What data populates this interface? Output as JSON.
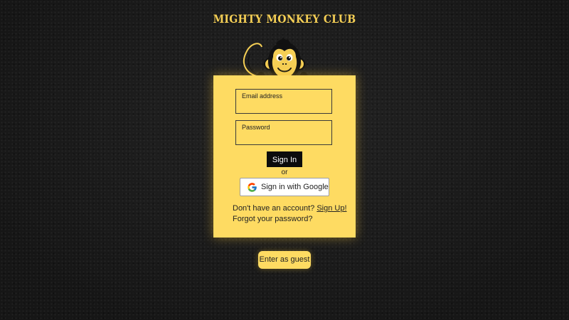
{
  "app": {
    "title": "MIGHTY MONKEY CLUB"
  },
  "login": {
    "email_label": "Email address",
    "email_value": "",
    "password_label": "Password",
    "password_value": "",
    "sign_in_label": "Sign In",
    "or_text": "or",
    "google_label": "Sign in with Google",
    "no_account_text": "Don't have an account?",
    "sign_up_label": "Sign Up!",
    "forgot_label": "Forgot your password?"
  },
  "guest": {
    "label": "Enter as guest"
  },
  "icons": {
    "mascot": "monkey-mascot-icon",
    "google": "google-g-icon"
  },
  "colors": {
    "accent": "#fedb62",
    "title": "#f5cf55",
    "background": "#1b1b1b",
    "button_dark": "#0c0c0c"
  }
}
